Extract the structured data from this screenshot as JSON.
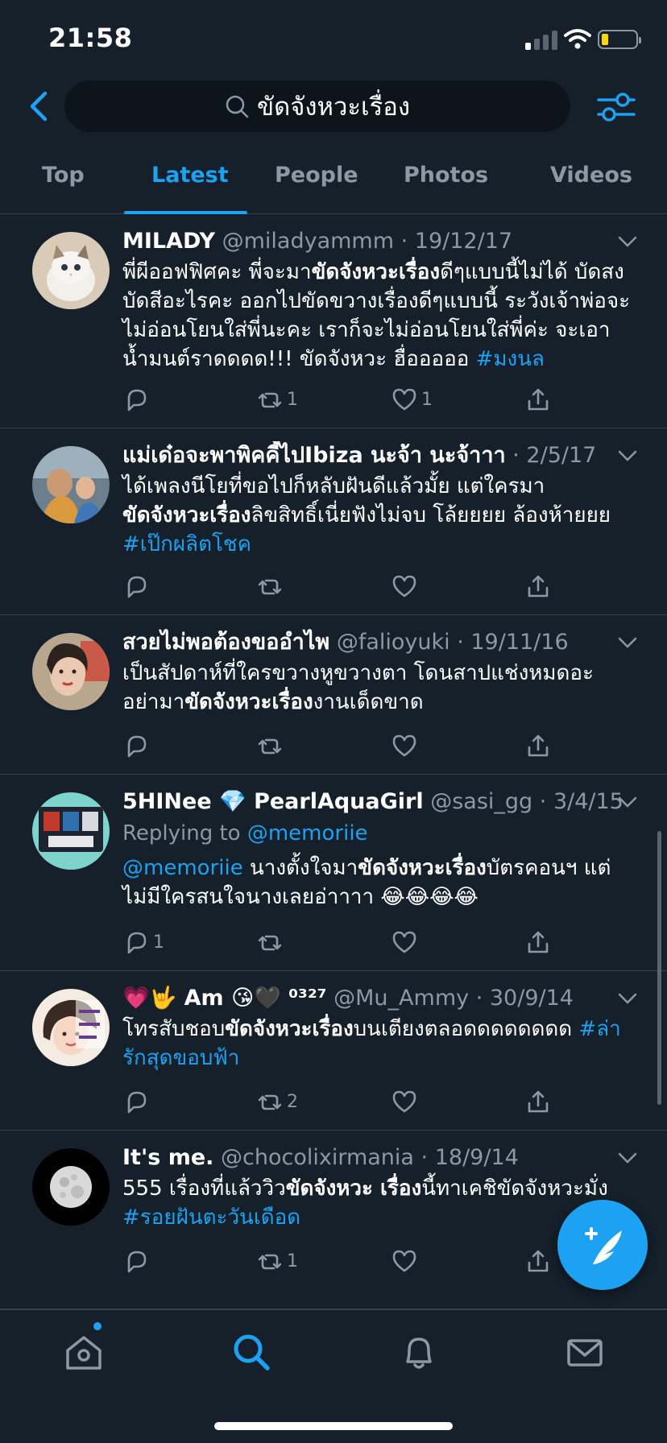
{
  "status_bar": {
    "time": "21:58"
  },
  "search": {
    "query": "ขัดจังหวะเรื่อง"
  },
  "tabs": [
    {
      "label": "Top"
    },
    {
      "label": "Latest"
    },
    {
      "label": "People"
    },
    {
      "label": "Photos"
    },
    {
      "label": "Videos"
    }
  ],
  "active_tab": "Latest",
  "colors": {
    "background": "#15202b",
    "accent": "#1da1f2",
    "muted": "#8b98a5",
    "divider": "#38444d"
  },
  "tweets": [
    {
      "name": "MILADY",
      "handle": "@miladyammm",
      "date": "19/12/17",
      "text": [
        {
          "t": "พี่ผีออฟฟิศคะ พี่จะมา"
        },
        {
          "t": "ขัดจังหวะเรื่อง",
          "b": true
        },
        {
          "t": "ดีๆแบบนี้ไม่ได้ บัดสง\nบัดสีอะไรคะ ออกไปขัดขวางเรื่องดีๆแบบนี้ ระวังเจ้าพ่อจะ\nไม่อ่อนโยนใส่พี่นะคะ เราก็จะไม่อ่อนโยนใส่พี่ค่ะ จะเอา\nน้ำมนต์ราดดดด!!! ขัดจังหวะ ฮื่อออออ "
        },
        {
          "t": "#มงนล",
          "link": true
        }
      ],
      "replies": "",
      "retweets": "1",
      "likes": "1"
    },
    {
      "name": "แม่เด๋อจะพาพิคคี้ไปIbiza นะจ้า นะจ้าาา",
      "handle": "",
      "date": "2/5/17",
      "text": [
        {
          "t": "ได้เพลงนีโยที่ขอไปก็หลับฝันดีแล้วมั้ย แต่ใครมา\n"
        },
        {
          "t": "ขัดจังหวะเรื่อง",
          "b": true
        },
        {
          "t": "ลิขสิทธิ์เนี่ยฟังไม่จบ โล้ยยยย ล้องห้ายยย\n"
        },
        {
          "t": "#เป๊กผลิตโชค",
          "link": true
        }
      ],
      "replies": "",
      "retweets": "",
      "likes": ""
    },
    {
      "name": "สวยไม่พอต้องขออำไพ",
      "handle": "@falioyuki",
      "date": "19/11/16",
      "text": [
        {
          "t": "เป็นสัปดาห์ที่ใครขวางหูขวางตา โดนสาปแช่งหมดอะ\nอย่ามา"
        },
        {
          "t": "ขัดจังหวะเรื่อง",
          "b": true
        },
        {
          "t": "งานเด็ดขาด"
        }
      ],
      "replies": "",
      "retweets": "",
      "likes": ""
    },
    {
      "name": "5HINee 💎 PearlAquaGirl",
      "handle": "@sasi_gg",
      "date": "3/4/15",
      "replying_label": "Replying to ",
      "replying_to": "@memoriie",
      "text": [
        {
          "t": "@memoriie",
          "link": true
        },
        {
          "t": " นางตั้งใจมา"
        },
        {
          "t": "ขัดจังหวะเรื่อง",
          "b": true
        },
        {
          "t": "บัตรคอนฯ แต่\nไม่มีใครสนใจนางเลยอ่าาาา 😂😂😂😂"
        }
      ],
      "replies": "1",
      "retweets": "",
      "likes": ""
    },
    {
      "name": "💗🤟 Am 😘🖤 ⁰³²⁷",
      "handle": "@Mu_Ammy",
      "date": "30/9/14",
      "text": [
        {
          "t": "โทรสับชอบ"
        },
        {
          "t": "ขัดจังหวะเรื่อง",
          "b": true
        },
        {
          "t": "บนเตียงตลอดดดดดดดด "
        },
        {
          "t": "#ล่า\nรักสุดขอบฟ้า",
          "link": true
        }
      ],
      "replies": "",
      "retweets": "2",
      "likes": ""
    },
    {
      "name": "It's me.",
      "handle": "@chocolixirmania",
      "date": "18/9/14",
      "text": [
        {
          "t": "555 เรื่องที่แล้ววิว"
        },
        {
          "t": "ขัดจังหวะ เรื่อง",
          "b": true
        },
        {
          "t": "นี้ทาเคชิขัดจังหวะมั่ง\n"
        },
        {
          "t": "#รอยฝันตะวันเดือด",
          "link": true
        }
      ],
      "replies": "",
      "retweets": "1",
      "likes": ""
    }
  ],
  "icons": {
    "back": "chevron-left-icon",
    "filter": "sliders-icon",
    "compose": "compose-feather-icon",
    "tabbar": [
      "home-icon",
      "search-icon",
      "bell-icon",
      "mail-icon"
    ]
  }
}
